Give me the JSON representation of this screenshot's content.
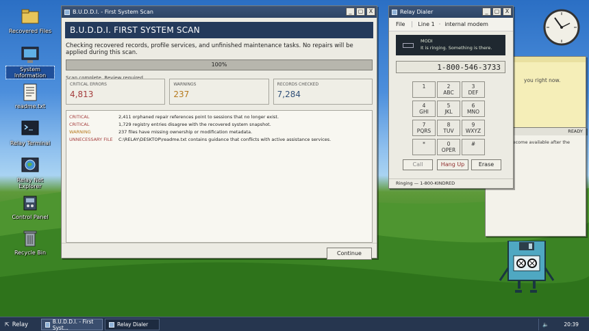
{
  "desktop": {
    "icons": [
      {
        "label": "Recovered Files",
        "icon": "folder-icon"
      },
      {
        "label": "System Information",
        "icon": "monitor-icon"
      },
      {
        "label": "readme.txt",
        "icon": "document-icon"
      },
      {
        "label": "Relay Terminal",
        "icon": "terminal-icon"
      },
      {
        "label": "Relay Net Explorer",
        "icon": "globe-icon"
      },
      {
        "label": "Control Panel",
        "icon": "control-panel-icon"
      },
      {
        "label": "Recycle Bin",
        "icon": "trash-icon"
      }
    ]
  },
  "scan_window": {
    "title": "B.U.D.D.I. - First System Scan",
    "controls": {
      "minimize": "_",
      "maximize": "▢",
      "close": "X"
    },
    "header": "B.U.D.D.I. FIRST SYSTEM SCAN",
    "description": "Checking recovered records, profile services, and unfinished maintenance tasks. No repairs will be applied during this scan.",
    "progress": {
      "percent_text": "100%",
      "value": 1.0
    },
    "status": "Scan complete. Review required.",
    "stats": [
      {
        "label": "CRITICAL ERRORS",
        "value": "4,813",
        "color": "#a43c3c"
      },
      {
        "label": "WARNINGS",
        "value": "237",
        "color": "#b5781a"
      },
      {
        "label": "RECORDS CHECKED",
        "value": "7,284",
        "color": "#2f4f78"
      }
    ],
    "log": [
      {
        "severity": "CRITICAL",
        "color": "#a43c3c",
        "message": "2,411 orphaned repair references point to sessions that no longer exist."
      },
      {
        "severity": "CRITICAL",
        "color": "#a43c3c",
        "message": "1,729 registry entries disagree with the recovered system snapshot."
      },
      {
        "severity": "WARNING",
        "color": "#b5781a",
        "message": "237 files have missing ownership or modification metadata."
      },
      {
        "severity": "UNNECESSARY FILE",
        "color": "#a43c3c",
        "message": "C:\\RELAY\\DESKTOP\\readme.txt contains guidance that conflicts with active assistance services."
      }
    ],
    "continue_label": "Continue"
  },
  "dialer": {
    "title": "Relay Dialer",
    "controls": {
      "minimize": "_",
      "maximize": "▢",
      "close": "X"
    },
    "menu": {
      "file": "File",
      "line": "Line 1",
      "device": "internal modem"
    },
    "lcd": {
      "label": "MODI",
      "message": "It is ringing. Something is there."
    },
    "number": "1-800-546-3733",
    "keys": [
      {
        "n": "1",
        "l": ""
      },
      {
        "n": "2",
        "l": "ABC"
      },
      {
        "n": "3",
        "l": "DEF"
      },
      {
        "n": "4",
        "l": "GHI"
      },
      {
        "n": "5",
        "l": "JKL"
      },
      {
        "n": "6",
        "l": "MNO"
      },
      {
        "n": "7",
        "l": "PQRS"
      },
      {
        "n": "8",
        "l": "TUV"
      },
      {
        "n": "9",
        "l": "WXYZ"
      },
      {
        "n": "*",
        "l": ""
      },
      {
        "n": "0",
        "l": "OPER"
      },
      {
        "n": "#",
        "l": ""
      }
    ],
    "actions": {
      "call": "Call",
      "hang_up": "Hang Up",
      "erase": "Erase"
    },
    "status": "Ringing — 1-800-KINDRED"
  },
  "background_windows": {
    "note_text": "you right now.",
    "panel_status": "READY",
    "panel_text": "s become available after the"
  },
  "taskbar": {
    "start_label": "Relay",
    "tasks": [
      "B.U.D.D.I. - First Syst...",
      "Relay Dialer"
    ],
    "time": "20:39"
  }
}
